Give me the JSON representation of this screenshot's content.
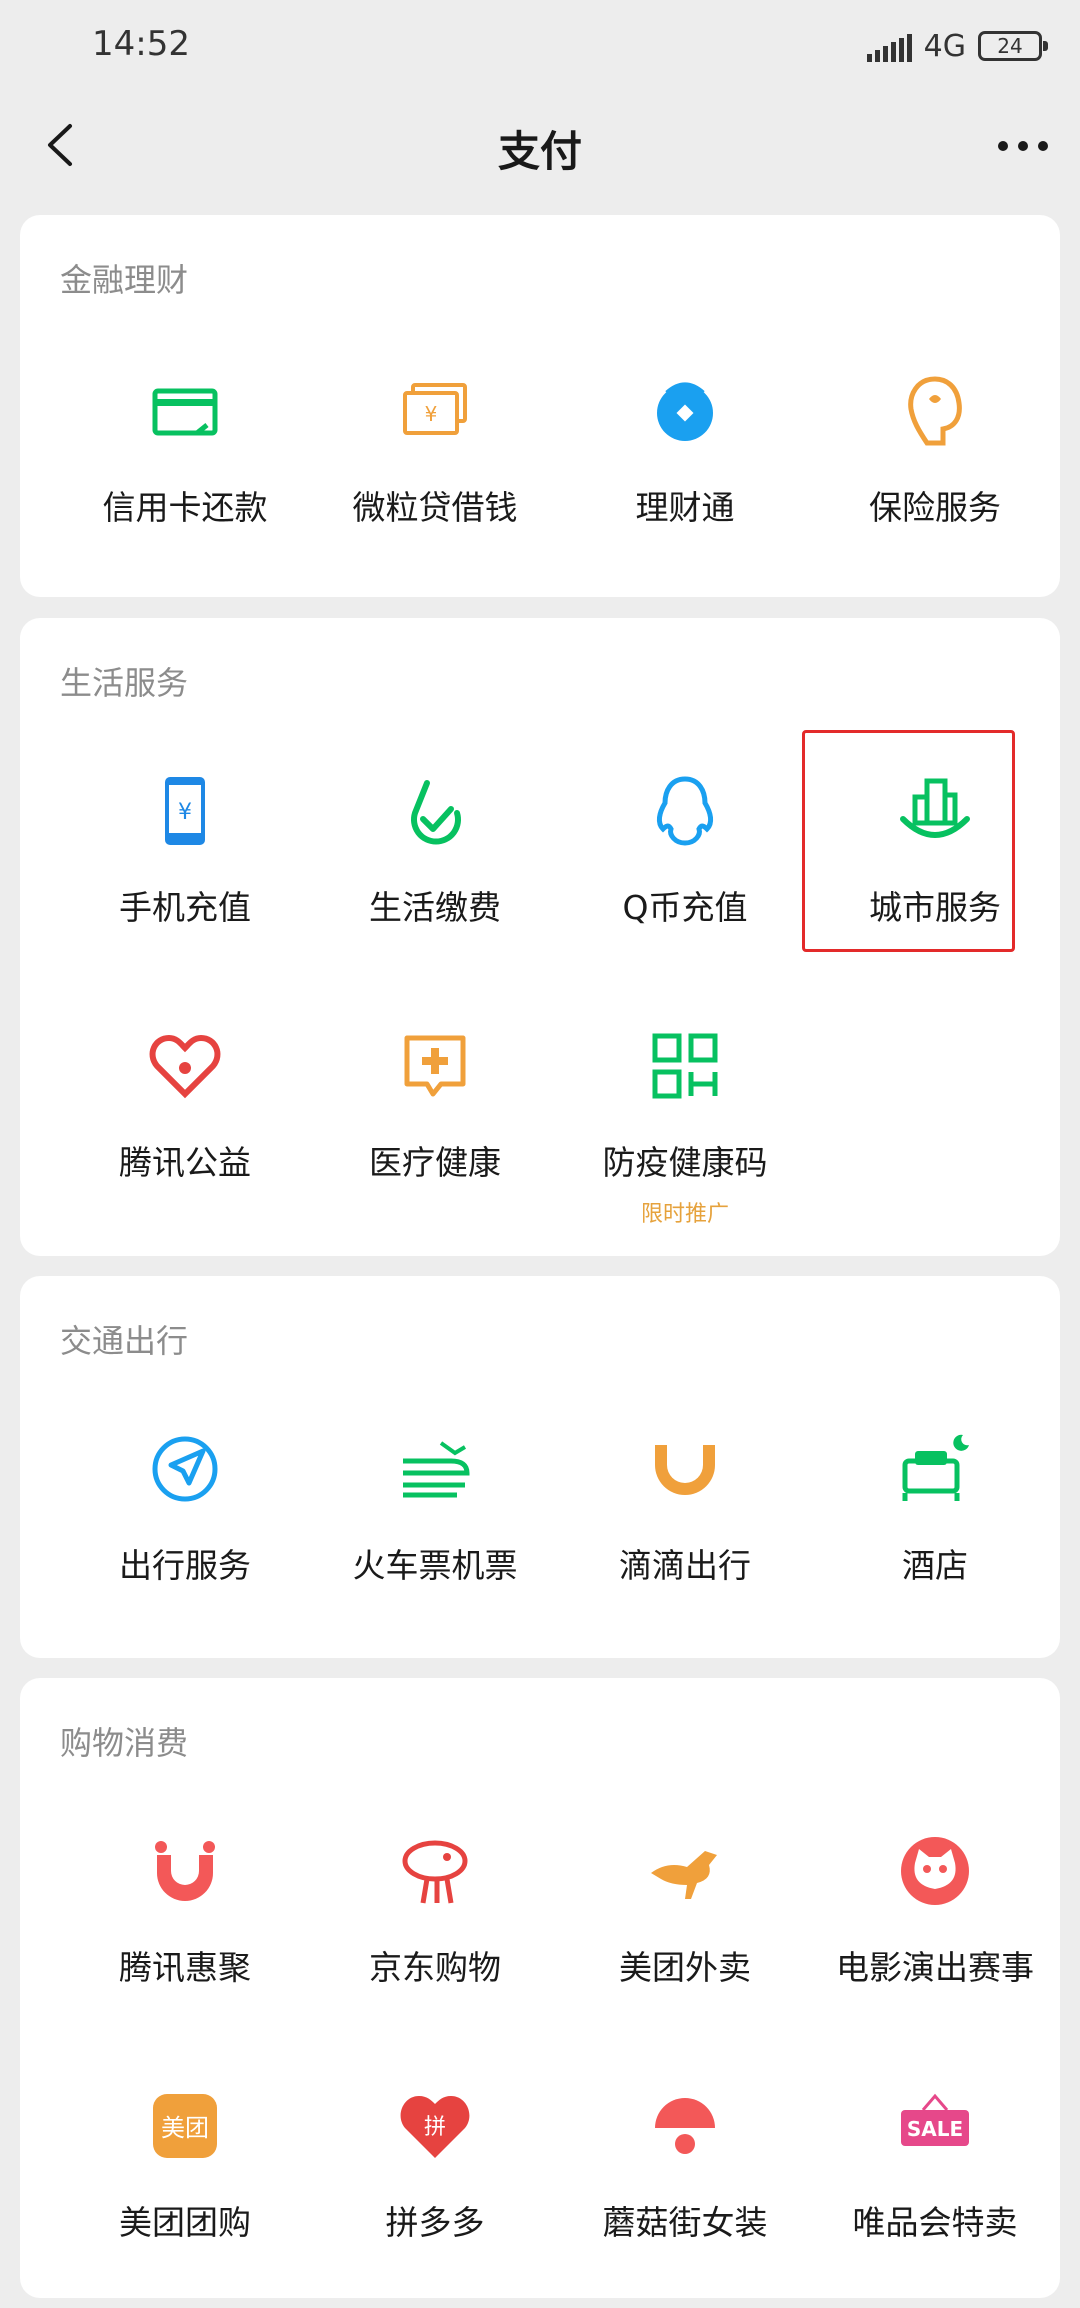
{
  "status": {
    "time": "14:52",
    "network": "4G",
    "battery": "24"
  },
  "nav": {
    "title": "支付"
  },
  "sections": [
    {
      "title": "金融理财",
      "items": [
        {
          "label": "信用卡还款",
          "icon": "credit-card-icon",
          "color": "#07c160"
        },
        {
          "label": "微粒贷借钱",
          "icon": "loan-icon",
          "color": "#f0a03b"
        },
        {
          "label": "理财通",
          "icon": "wealth-icon",
          "color": "#1aa0f0"
        },
        {
          "label": "保险服务",
          "icon": "insurance-icon",
          "color": "#f0a03b"
        }
      ]
    },
    {
      "title": "生活服务",
      "items": [
        {
          "label": "手机充值",
          "icon": "phone-topup-icon",
          "color": "#1e88e5"
        },
        {
          "label": "生活缴费",
          "icon": "utility-icon",
          "color": "#07c160"
        },
        {
          "label": "Q币充值",
          "icon": "qq-icon",
          "color": "#1aa0f0"
        },
        {
          "label": "城市服务",
          "icon": "city-icon",
          "color": "#07c160"
        },
        {
          "label": "腾讯公益",
          "icon": "charity-icon",
          "color": "#e64340"
        },
        {
          "label": "医疗健康",
          "icon": "medical-icon",
          "color": "#f0a03b"
        },
        {
          "label": "防疫健康码",
          "icon": "qr-code-icon",
          "color": "#07c160",
          "sub": "限时推广"
        }
      ]
    },
    {
      "title": "交通出行",
      "items": [
        {
          "label": "出行服务",
          "icon": "navigation-icon",
          "color": "#1aa0f0"
        },
        {
          "label": "火车票机票",
          "icon": "train-icon",
          "color": "#07c160"
        },
        {
          "label": "滴滴出行",
          "icon": "didi-icon",
          "color": "#f0a03b"
        },
        {
          "label": "酒店",
          "icon": "hotel-icon",
          "color": "#07c160"
        }
      ]
    },
    {
      "title": "购物消费",
      "items": [
        {
          "label": "腾讯惠聚",
          "icon": "tencent-huiju-icon",
          "color": "#f35858"
        },
        {
          "label": "京东购物",
          "icon": "jd-icon",
          "color": "#e64340"
        },
        {
          "label": "美团外卖",
          "icon": "meituan-waimai-icon",
          "color": "#f0a03b"
        },
        {
          "label": "电影演出赛事",
          "icon": "movie-cat-icon",
          "color": "#f35858"
        },
        {
          "label": "美团团购",
          "icon": "meituan-icon",
          "color": "#f0a03b",
          "badge": "美团"
        },
        {
          "label": "拼多多",
          "icon": "pinduoduo-icon",
          "color": "#e64340",
          "badge": "拼"
        },
        {
          "label": "蘑菇街女装",
          "icon": "mogujie-icon",
          "color": "#f35858"
        },
        {
          "label": "唯品会特卖",
          "icon": "vip-sale-icon",
          "color": "#e6488a",
          "badge": "SALE"
        }
      ]
    }
  ]
}
